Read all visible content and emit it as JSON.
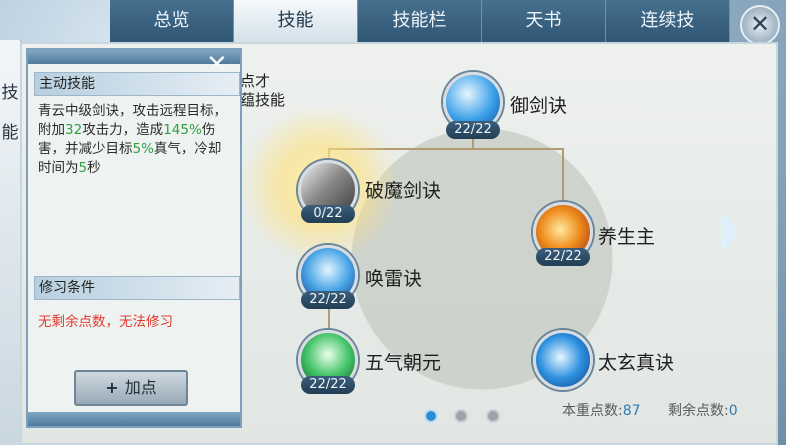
{
  "tabs": [
    {
      "label": "总览",
      "active": false
    },
    {
      "label": "技能",
      "active": true
    },
    {
      "label": "技能栏",
      "active": false
    },
    {
      "label": "天书",
      "active": false
    },
    {
      "label": "连续技",
      "active": false
    }
  ],
  "side_strip": {
    "chars": [
      "技",
      "能"
    ]
  },
  "info": {
    "active_skill_title": "主动技能",
    "desc": {
      "p1": "青云中级剑诀，攻击远程目标，附加",
      "v1": "32",
      "p2": "攻击力，造成",
      "v2": "145%",
      "p3": "伤害，并减少目标",
      "v3": "5%",
      "p4": "真气，冷却时间为",
      "v4": "5",
      "p5": "秒"
    },
    "requirement_title": "修习条件",
    "requirement_text": "无剩余点数，无法修习",
    "add_button": "加点"
  },
  "hint_partial": {
    "line1": "点才",
    "line2": "蕴技能"
  },
  "skills": [
    {
      "name": "御剑诀",
      "count": "22/22",
      "icon": "sword-energy-icon"
    },
    {
      "name": "破魔剑诀",
      "count": "0/22",
      "icon": "demon-breaker-sword-icon",
      "selected": true
    },
    {
      "name": "养生主",
      "count": "22/22",
      "icon": "fire-palm-icon"
    },
    {
      "name": "唤雷诀",
      "count": "22/22",
      "icon": "thunder-icon"
    },
    {
      "name": "五气朝元",
      "count": "22/22",
      "icon": "qi-figure-icon"
    },
    {
      "name": "太玄真诀",
      "count": "22/22",
      "icon": "vortex-icon"
    }
  ],
  "pagination": {
    "pages": 3,
    "current": 1
  },
  "points": {
    "total_label": "本重点数:",
    "total_value": "87",
    "remaining_label": "剩余点数:",
    "remaining_value": "0"
  },
  "colors": {
    "highlight_green": "#2ea043",
    "warning_red": "#e03a2e",
    "accent_blue": "#2e7bb5"
  }
}
